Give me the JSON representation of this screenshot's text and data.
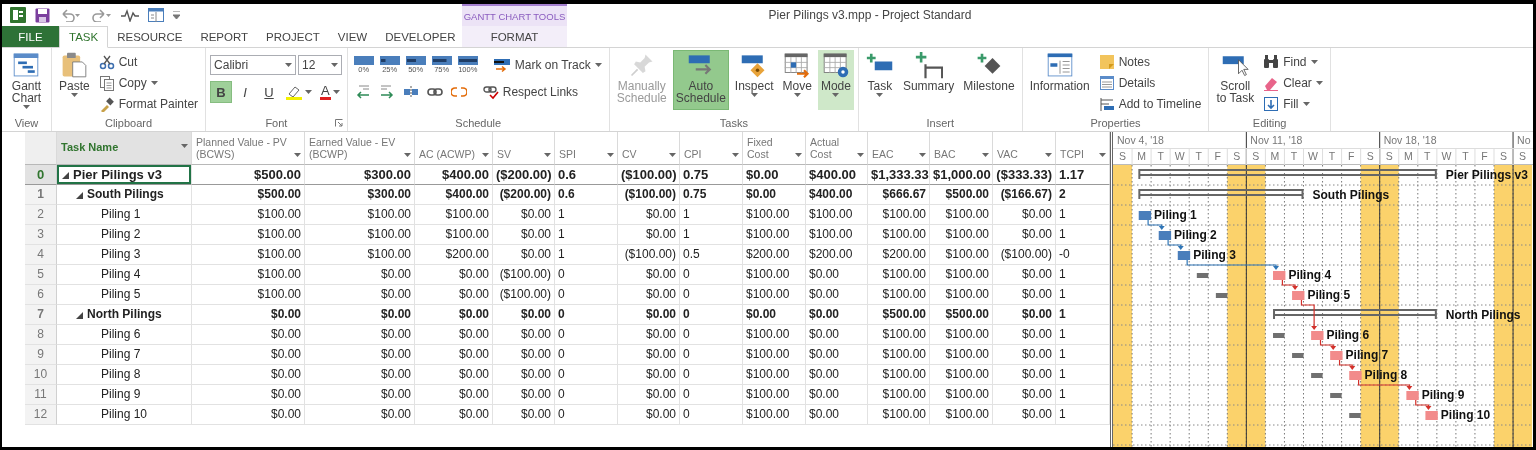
{
  "titlebar": {
    "context_label": "GANTT CHART TOOLS",
    "title": "Pier Pilings v3.mpp - Project Standard"
  },
  "tabs": [
    {
      "label": "FILE",
      "kind": "file",
      "selected": false
    },
    {
      "label": "TASK",
      "kind": "normal",
      "selected": true
    },
    {
      "label": "RESOURCE",
      "kind": "normal",
      "selected": false
    },
    {
      "label": "REPORT",
      "kind": "normal",
      "selected": false
    },
    {
      "label": "PROJECT",
      "kind": "normal",
      "selected": false
    },
    {
      "label": "VIEW",
      "kind": "normal",
      "selected": false
    },
    {
      "label": "DEVELOPER",
      "kind": "normal",
      "selected": false
    },
    {
      "label": "FORMAT",
      "kind": "contextual",
      "selected": false
    }
  ],
  "ribbon": {
    "groups": [
      {
        "label": "View",
        "items": [
          {
            "kind": "large",
            "label": "Gantt\nChart",
            "dropdown": true,
            "selected": false,
            "hovered": false,
            "disabled": false
          }
        ]
      },
      {
        "label": "Clipboard",
        "items": [
          {
            "kind": "large",
            "label": "Paste",
            "dropdown": true,
            "selected": false,
            "hovered": false,
            "disabled": false
          },
          {
            "kind": "small",
            "label": "Cut",
            "dropdown": false
          },
          {
            "kind": "small",
            "label": "Copy",
            "dropdown": true
          },
          {
            "kind": "small",
            "label": "Format Painter",
            "dropdown": false
          }
        ]
      },
      {
        "label": "Font",
        "launcher": true,
        "tiers": [
          {
            "items": [
              {
                "kind": "combo",
                "value": "Calibri"
              },
              {
                "kind": "combo",
                "value": "12"
              }
            ]
          },
          {
            "items": [
              {
                "kind": "toggle",
                "label": "B",
                "selected": true
              },
              {
                "kind": "toggle",
                "label": "I",
                "selected": false
              },
              {
                "kind": "toggle",
                "label": "U",
                "selected": false
              },
              {
                "kind": "icon",
                "dropdown": true
              },
              {
                "kind": "icon",
                "label": "A",
                "dropdown": true
              }
            ]
          }
        ]
      },
      {
        "label": "Schedule",
        "tiers": [
          {
            "items": [
              {
                "kind": "pct",
                "label": "0%"
              },
              {
                "kind": "pct",
                "label": "25%"
              },
              {
                "kind": "pct",
                "label": "50%"
              },
              {
                "kind": "pct",
                "label": "75%"
              },
              {
                "kind": "pct",
                "label": "100%"
              },
              {
                "kind": "small",
                "label": "Mark on Track",
                "dropdown": true
              }
            ]
          },
          {
            "items": [
              {
                "kind": "icon",
                "dropdown": false
              },
              {
                "kind": "icon",
                "dropdown": false
              },
              {
                "kind": "icon",
                "dropdown": false
              },
              {
                "kind": "icon",
                "dropdown": false
              },
              {
                "kind": "icon",
                "dropdown": false
              },
              {
                "kind": "small",
                "label": "Respect Links",
                "dropdown": false
              }
            ]
          }
        ]
      },
      {
        "label": "Tasks",
        "items": [
          {
            "kind": "large",
            "label": "Manually\nSchedule",
            "dropdown": false,
            "selected": false,
            "hovered": false,
            "disabled": true
          },
          {
            "kind": "large",
            "label": "Auto\nSchedule",
            "dropdown": false,
            "selected": true,
            "hovered": false,
            "disabled": false
          },
          {
            "kind": "large",
            "label": "Inspect",
            "dropdown": true,
            "selected": false,
            "hovered": false,
            "disabled": false
          },
          {
            "kind": "large",
            "label": "Move",
            "dropdown": true,
            "selected": false,
            "hovered": false,
            "disabled": false
          },
          {
            "kind": "large",
            "label": "Mode",
            "dropdown": true,
            "selected": false,
            "hovered": true,
            "disabled": false
          }
        ]
      },
      {
        "label": "Insert",
        "items": [
          {
            "kind": "large",
            "label": "Task",
            "dropdown": true,
            "selected": false,
            "hovered": false,
            "disabled": false
          },
          {
            "kind": "large",
            "label": "Summary",
            "dropdown": false,
            "selected": false,
            "hovered": false,
            "disabled": false
          },
          {
            "kind": "large",
            "label": "Milestone",
            "dropdown": false,
            "selected": false,
            "hovered": false,
            "disabled": false
          }
        ]
      },
      {
        "label": "Properties",
        "items": [
          {
            "kind": "large",
            "label": "Information",
            "dropdown": false,
            "selected": false,
            "hovered": false,
            "disabled": false
          },
          {
            "kind": "small",
            "label": "Notes",
            "dropdown": false
          },
          {
            "kind": "small",
            "label": "Details",
            "dropdown": false
          },
          {
            "kind": "small",
            "label": "Add to Timeline",
            "dropdown": false
          }
        ]
      },
      {
        "label": "Editing",
        "items": [
          {
            "kind": "large",
            "label": "Scroll\nto Task",
            "dropdown": false,
            "selected": false,
            "hovered": false,
            "disabled": false
          },
          {
            "kind": "small",
            "label": "Find",
            "dropdown": true
          },
          {
            "kind": "small",
            "label": "Clear",
            "dropdown": true
          },
          {
            "kind": "small",
            "label": "Fill",
            "dropdown": true
          }
        ]
      }
    ]
  },
  "sheet": {
    "columns": [
      {
        "label": "Task Name",
        "selected": true
      },
      {
        "label": "Planned Value - PV (BCWS)",
        "selected": false
      },
      {
        "label": "Earned Value - EV (BCWP)",
        "selected": false
      },
      {
        "label": "AC (ACWP)",
        "selected": false
      },
      {
        "label": "SV",
        "selected": false
      },
      {
        "label": "SPI",
        "selected": false
      },
      {
        "label": "CV",
        "selected": false
      },
      {
        "label": "CPI",
        "selected": false
      },
      {
        "label": "Fixed Cost",
        "selected": false
      },
      {
        "label": "Actual Cost",
        "selected": false
      },
      {
        "label": "EAC",
        "selected": false
      },
      {
        "label": "BAC",
        "selected": false
      },
      {
        "label": "VAC",
        "selected": false
      },
      {
        "label": "TCPI",
        "selected": false
      }
    ],
    "tasks": [
      {
        "id": "0",
        "name": "Pier Pilings v3",
        "kind": "project",
        "expanded": true,
        "selected": true,
        "values": [
          "$500.00",
          "$300.00",
          "$400.00",
          "($200.00)",
          "0.6",
          "($100.00)",
          "0.75",
          "$0.00",
          "$400.00",
          "$1,333.33",
          "$1,000.00",
          "($333.33)",
          "1.17"
        ],
        "children": [
          {
            "id": "1",
            "name": "South Pilings",
            "kind": "summary",
            "expanded": true,
            "selected": false,
            "values": [
              "$500.00",
              "$300.00",
              "$400.00",
              "($200.00)",
              "0.6",
              "($100.00)",
              "0.75",
              "$0.00",
              "$400.00",
              "$666.67",
              "$500.00",
              "($166.67)",
              "2"
            ],
            "children": [
              {
                "id": "2",
                "name": "Piling 1",
                "kind": "task",
                "selected": false,
                "values": [
                  "$100.00",
                  "$100.00",
                  "$100.00",
                  "$0.00",
                  "1",
                  "$0.00",
                  "1",
                  "$100.00",
                  "$100.00",
                  "$100.00",
                  "$100.00",
                  "$0.00",
                  "1"
                ]
              },
              {
                "id": "3",
                "name": "Piling 2",
                "kind": "task",
                "selected": false,
                "values": [
                  "$100.00",
                  "$100.00",
                  "$100.00",
                  "$0.00",
                  "1",
                  "$0.00",
                  "1",
                  "$100.00",
                  "$100.00",
                  "$100.00",
                  "$100.00",
                  "$0.00",
                  "1"
                ]
              },
              {
                "id": "4",
                "name": "Piling 3",
                "kind": "task",
                "selected": false,
                "values": [
                  "$100.00",
                  "$100.00",
                  "$200.00",
                  "$0.00",
                  "1",
                  "($100.00)",
                  "0.5",
                  "$200.00",
                  "$200.00",
                  "$200.00",
                  "$100.00",
                  "($100.00)",
                  "-0"
                ]
              },
              {
                "id": "5",
                "name": "Piling 4",
                "kind": "task",
                "selected": false,
                "values": [
                  "$100.00",
                  "$0.00",
                  "$0.00",
                  "($100.00)",
                  "0",
                  "$0.00",
                  "0",
                  "$100.00",
                  "$0.00",
                  "$100.00",
                  "$100.00",
                  "$0.00",
                  "1"
                ]
              },
              {
                "id": "6",
                "name": "Piling 5",
                "kind": "task",
                "selected": false,
                "values": [
                  "$100.00",
                  "$0.00",
                  "$0.00",
                  "($100.00)",
                  "0",
                  "$0.00",
                  "0",
                  "$100.00",
                  "$0.00",
                  "$100.00",
                  "$100.00",
                  "$0.00",
                  "1"
                ]
              }
            ]
          },
          {
            "id": "7",
            "name": "North Pilings",
            "kind": "summary",
            "expanded": true,
            "selected": false,
            "values": [
              "$0.00",
              "$0.00",
              "$0.00",
              "$0.00",
              "0",
              "$0.00",
              "0",
              "$0.00",
              "$0.00",
              "$500.00",
              "$500.00",
              "$0.00",
              "1"
            ],
            "children": [
              {
                "id": "8",
                "name": "Piling 6",
                "kind": "task",
                "selected": false,
                "values": [
                  "$0.00",
                  "$0.00",
                  "$0.00",
                  "$0.00",
                  "0",
                  "$0.00",
                  "0",
                  "$100.00",
                  "$0.00",
                  "$100.00",
                  "$100.00",
                  "$0.00",
                  "1"
                ]
              },
              {
                "id": "9",
                "name": "Piling 7",
                "kind": "task",
                "selected": false,
                "values": [
                  "$0.00",
                  "$0.00",
                  "$0.00",
                  "$0.00",
                  "0",
                  "$0.00",
                  "0",
                  "$100.00",
                  "$0.00",
                  "$100.00",
                  "$100.00",
                  "$0.00",
                  "1"
                ]
              },
              {
                "id": "10",
                "name": "Piling 8",
                "kind": "task",
                "selected": false,
                "values": [
                  "$0.00",
                  "$0.00",
                  "$0.00",
                  "$0.00",
                  "0",
                  "$0.00",
                  "0",
                  "$100.00",
                  "$0.00",
                  "$100.00",
                  "$100.00",
                  "$0.00",
                  "1"
                ]
              },
              {
                "id": "11",
                "name": "Piling 9",
                "kind": "task",
                "selected": false,
                "values": [
                  "$0.00",
                  "$0.00",
                  "$0.00",
                  "$0.00",
                  "0",
                  "$0.00",
                  "0",
                  "$100.00",
                  "$0.00",
                  "$100.00",
                  "$100.00",
                  "$0.00",
                  "1"
                ]
              },
              {
                "id": "12",
                "name": "Piling 10",
                "kind": "task",
                "selected": false,
                "values": [
                  "$0.00",
                  "$0.00",
                  "$0.00",
                  "$0.00",
                  "0",
                  "$0.00",
                  "0",
                  "$100.00",
                  "$0.00",
                  "$100.00",
                  "$100.00",
                  "$0.00",
                  "1"
                ]
              }
            ]
          }
        ]
      }
    ]
  },
  "gantt": {
    "timescale": {
      "weeks": [
        "Nov 4, '18",
        "Nov 11, '18",
        "Nov 18, '18",
        "No"
      ],
      "days": [
        "S",
        "M",
        "T",
        "W",
        "T",
        "F",
        "S",
        "S",
        "M",
        "T",
        "W",
        "T",
        "F",
        "S",
        "S",
        "M",
        "T",
        "W",
        "T",
        "F",
        "S",
        "S"
      ]
    },
    "bars": [
      {
        "label": "Pier Pilings v3",
        "kind": "project"
      },
      {
        "label": "South Pilings",
        "kind": "summary"
      },
      {
        "label": "Piling 1",
        "kind": "task",
        "critical": false
      },
      {
        "label": "Piling 2",
        "kind": "task",
        "critical": false
      },
      {
        "label": "Piling 3",
        "kind": "task",
        "critical": false
      },
      {
        "label": "Piling 4",
        "kind": "task",
        "critical": true
      },
      {
        "label": "Piling 5",
        "kind": "task",
        "critical": true
      },
      {
        "label": "North Pilings",
        "kind": "summary"
      },
      {
        "label": "Piling 6",
        "kind": "task",
        "critical": true
      },
      {
        "label": "Piling 7",
        "kind": "task",
        "critical": true
      },
      {
        "label": "Piling 8",
        "kind": "task",
        "critical": true
      },
      {
        "label": "Piling 9",
        "kind": "task",
        "critical": true
      },
      {
        "label": "Piling 10",
        "kind": "task",
        "critical": true
      }
    ]
  }
}
